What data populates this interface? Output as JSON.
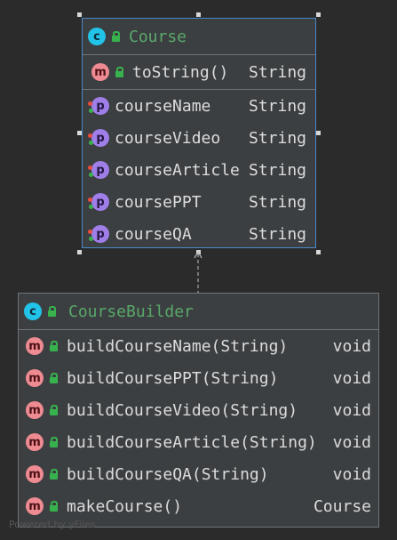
{
  "course": {
    "name": "Course",
    "badge": "c",
    "methods": [
      {
        "badge": "m",
        "name": "toString()",
        "type": "String"
      }
    ],
    "properties": [
      {
        "badge": "p",
        "name": "courseName",
        "type": "String"
      },
      {
        "badge": "p",
        "name": "courseVideo",
        "type": "String"
      },
      {
        "badge": "p",
        "name": "courseArticle",
        "type": "String"
      },
      {
        "badge": "p",
        "name": "coursePPT",
        "type": "String"
      },
      {
        "badge": "p",
        "name": "courseQA",
        "type": "String"
      }
    ]
  },
  "builder": {
    "name": "CourseBuilder",
    "badge": "c",
    "methods": [
      {
        "badge": "m",
        "name": "buildCourseName(String)",
        "type": "void"
      },
      {
        "badge": "m",
        "name": "buildCoursePPT(String)",
        "type": "void"
      },
      {
        "badge": "m",
        "name": "buildCourseVideo(String)",
        "type": "void"
      },
      {
        "badge": "m",
        "name": "buildCourseArticle(String)",
        "type": "void"
      },
      {
        "badge": "m",
        "name": "buildCourseQA(String)",
        "type": "void"
      },
      {
        "badge": "m",
        "name": "makeCourse()",
        "type": "Course"
      }
    ]
  },
  "footer": "Powered by yFiles",
  "colors": {
    "class_badge": "#22c3e8",
    "method_badge": "#ee8a91",
    "property_badge": "#9f7ee8",
    "class_name": "#59a869",
    "selection": "#4a88c7"
  }
}
